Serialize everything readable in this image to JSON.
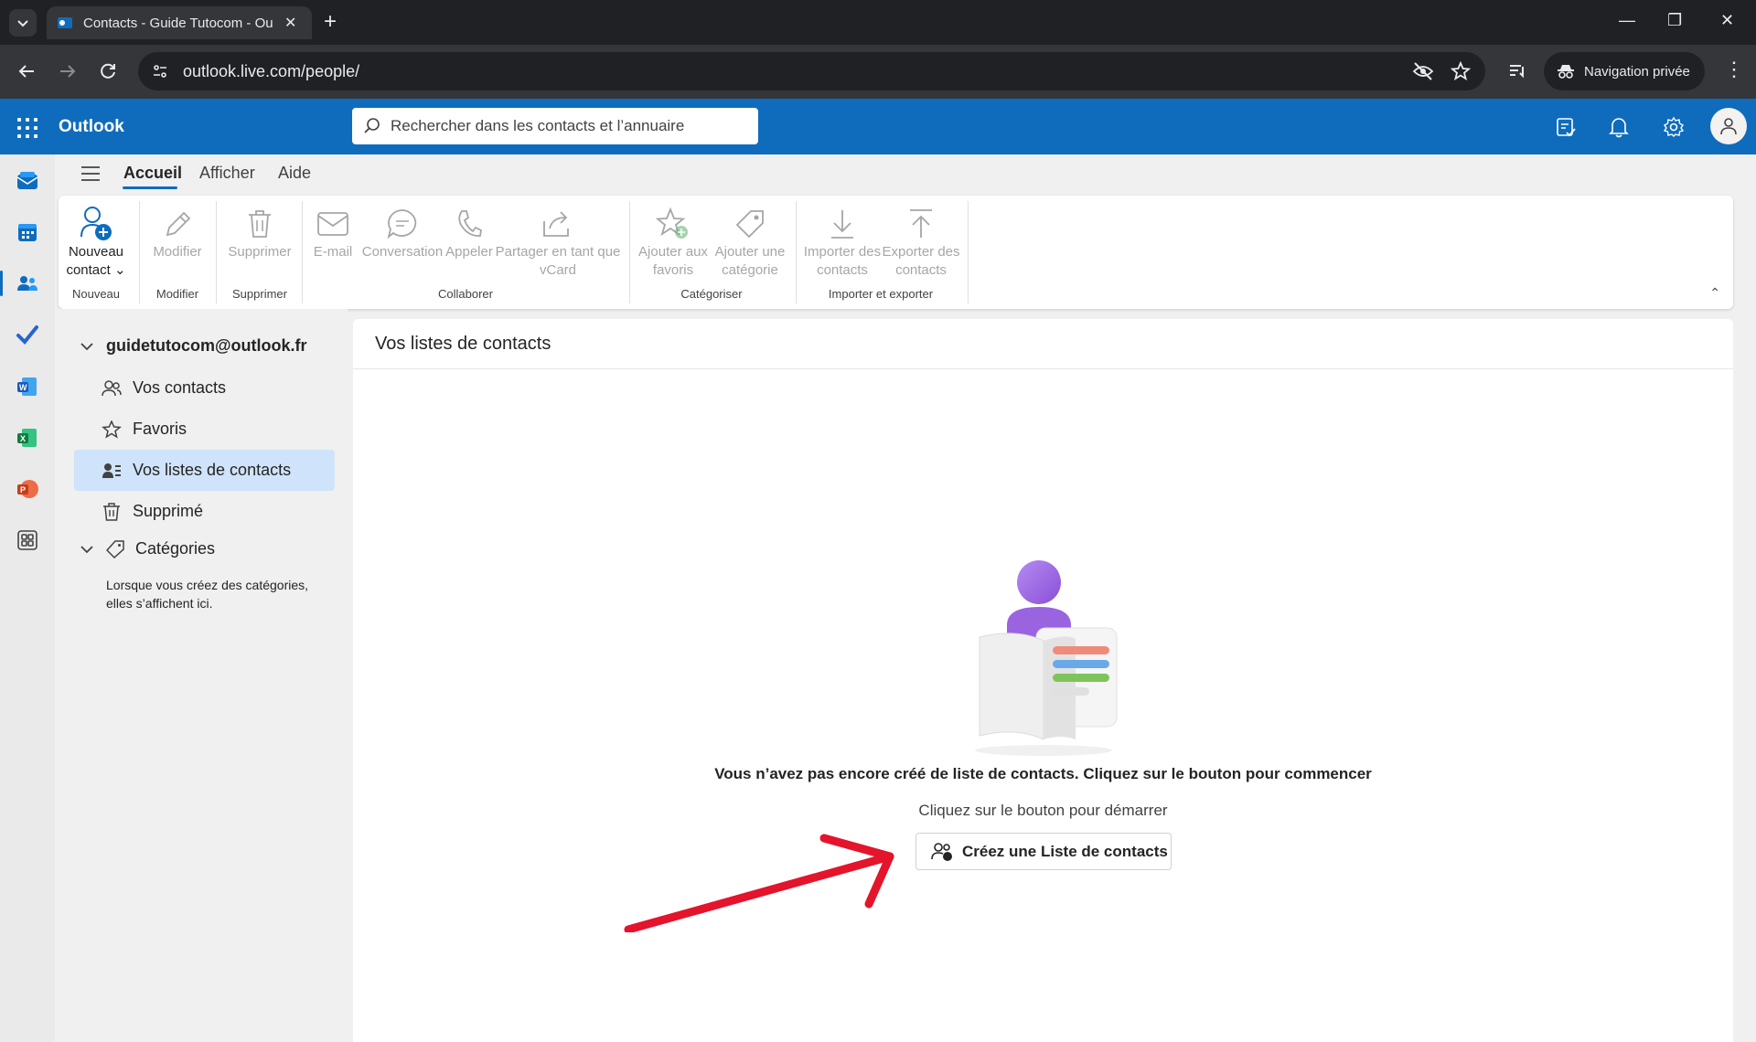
{
  "browser": {
    "tab_title": "Contacts - Guide Tutocom - Ou",
    "url": "outlook.live.com/people/",
    "incognito_label": "Navigation privée"
  },
  "app": {
    "brand": "Outlook",
    "search_placeholder": "Rechercher dans les contacts et l’annuaire",
    "accent": "#0f6cbd"
  },
  "ribbon_tabs": [
    "Accueil",
    "Afficher",
    "Aide"
  ],
  "ribbon": {
    "nouveau_l1": "Nouveau",
    "nouveau_l2": "contact",
    "modifier": "Modifier",
    "supprimer": "Supprimer",
    "email": "E-mail",
    "conversation": "Conversation",
    "appeler": "Appeler",
    "partager_l1": "Partager en tant que",
    "partager_l2": "vCard",
    "favoris_l1": "Ajouter aux",
    "favoris_l2": "favoris",
    "categorie_l1": "Ajouter une",
    "categorie_l2": "catégorie",
    "importer_l1": "Importer des",
    "importer_l2": "contacts",
    "exporter_l1": "Exporter des",
    "exporter_l2": "contacts",
    "groups": {
      "nouveau": "Nouveau",
      "modifier": "Modifier",
      "supprimer": "Supprimer",
      "collaborer": "Collaborer",
      "categoriser": "Catégoriser",
      "import_export": "Importer et exporter"
    }
  },
  "folders": {
    "account": "guidetutocom@outlook.fr",
    "items": [
      "Vos contacts",
      "Favoris",
      "Vos listes de contacts",
      "Supprimé"
    ],
    "categories_label": "Catégories",
    "categories_note": "Lorsque vous créez des catégories, elles s’affichent ici."
  },
  "main": {
    "title": "Vos listes de contacts",
    "empty_message": "Vous n’avez pas encore créé de liste de contacts. Cliquez sur le bouton pour commencer",
    "empty_sub": "Cliquez sur le bouton pour démarrer",
    "create_button": "Créez une Liste de contacts"
  }
}
